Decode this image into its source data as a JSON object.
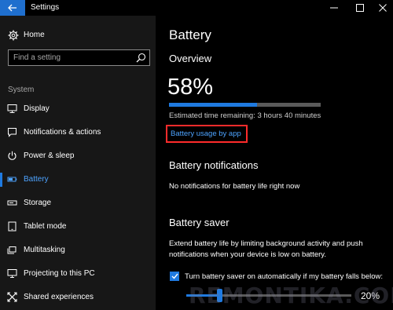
{
  "titlebar": {
    "app_title": "Settings"
  },
  "sidebar": {
    "home_label": "Home",
    "search_placeholder": "Find a setting",
    "section_label": "System",
    "items": [
      {
        "label": "Display",
        "icon": "monitor-icon"
      },
      {
        "label": "Notifications & actions",
        "icon": "message-icon"
      },
      {
        "label": "Power & sleep",
        "icon": "power-icon"
      },
      {
        "label": "Battery",
        "icon": "battery-icon",
        "active": true
      },
      {
        "label": "Storage",
        "icon": "storage-icon"
      },
      {
        "label": "Tablet mode",
        "icon": "tablet-icon"
      },
      {
        "label": "Multitasking",
        "icon": "multitasking-icon"
      },
      {
        "label": "Projecting to this PC",
        "icon": "projector-icon"
      },
      {
        "label": "Shared experiences",
        "icon": "shared-icon"
      }
    ]
  },
  "main": {
    "title": "Battery",
    "overview": {
      "heading": "Overview",
      "percent": "58%",
      "level": 0.58,
      "estimated": "Estimated time remaining: 3 hours 40 minutes",
      "usage_link": "Battery usage by app"
    },
    "notifications": {
      "heading": "Battery notifications",
      "text": "No notifications for battery life right now"
    },
    "saver": {
      "heading": "Battery saver",
      "description": "Extend battery life by limiting background activity and push notifications when your device is low on battery.",
      "checkbox_label": "Turn battery saver on automatically if my battery falls below:",
      "checked": true,
      "threshold_value": "20%",
      "threshold_level": 0.2
    }
  },
  "watermark": "REMONTIKA.COM",
  "colors": {
    "accent": "#1f7ae0",
    "link": "#4da3ff",
    "highlight": "#ff2b2b",
    "sidebar_bg": "#171717"
  }
}
